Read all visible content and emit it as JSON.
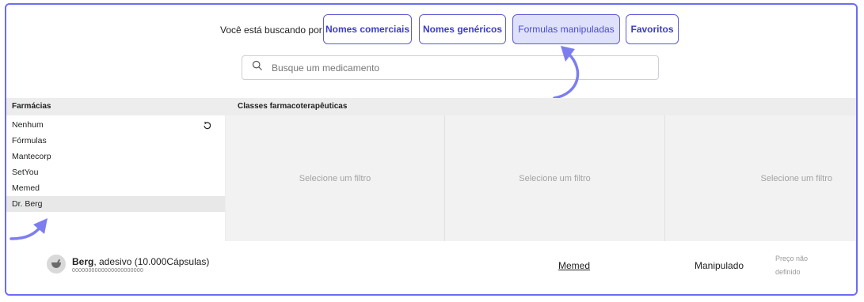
{
  "search_by_label": "Você está buscando por:",
  "tabs": [
    {
      "label": "Nomes comerciais",
      "active": false
    },
    {
      "label": "Nomes genéricos",
      "active": false
    },
    {
      "label": "Formulas manipuladas",
      "active": true
    },
    {
      "label": "Favoritos",
      "active": false
    }
  ],
  "search": {
    "placeholder": "Busque um medicamento",
    "icon": "search-icon"
  },
  "filters": {
    "pharmacies_header": "Farmácias",
    "classes_header": "Classes farmacoterapêuticas",
    "pharmacies": [
      "Nenhum",
      "Fórmulas",
      "Mantecorp",
      "SetYou",
      "Memed",
      "Dr. Berg"
    ],
    "selected_pharmacy": "Dr. Berg",
    "reset_icon": "reset-icon",
    "placeholder_cols": [
      "Selecione um filtro",
      "Selecione um filtro",
      "Selecione um filtro"
    ]
  },
  "result": {
    "icon": "mortar-icon",
    "name_bold": "Berg",
    "name_rest": ", adesivo (10.000Cápsulas)",
    "code": "0000000000000000000000",
    "pharmacy_link": "Memed",
    "type": "Manipulado",
    "price_line1": "Preço não",
    "price_line2": "definido"
  },
  "colors": {
    "accent": "#5b5bd6",
    "frame": "#6b6cf6",
    "arrow": "#7c7ef0"
  }
}
